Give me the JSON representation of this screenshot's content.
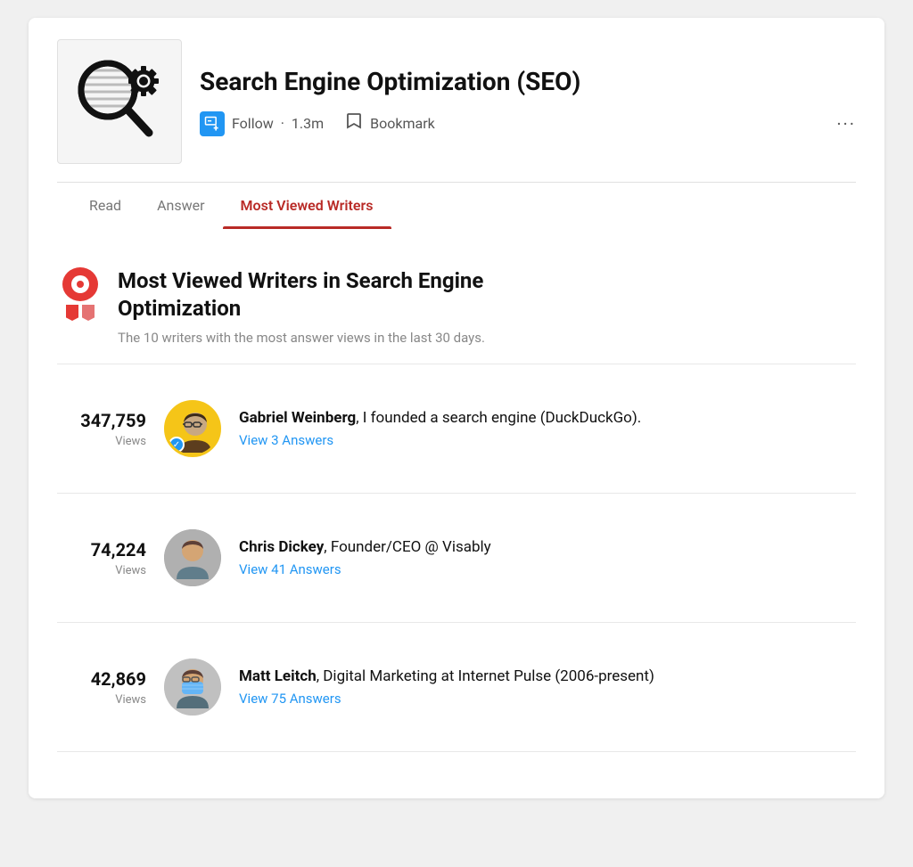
{
  "topic": {
    "title": "Search Engine Optimization (SEO)",
    "follow_label": "Follow",
    "follow_count": "1.3m",
    "bookmark_label": "Bookmark",
    "more_icon": "···"
  },
  "tabs": [
    {
      "id": "read",
      "label": "Read",
      "active": false
    },
    {
      "id": "answer",
      "label": "Answer",
      "active": false
    },
    {
      "id": "most-viewed-writers",
      "label": "Most Viewed Writers",
      "active": true
    }
  ],
  "mvw_section": {
    "heading_line1": "Most Viewed Writers in Search Engine",
    "heading_line2": "Optimization",
    "subtitle": "The 10 writers with the most answer views in the last 30 days.",
    "writers": [
      {
        "rank": 1,
        "views_count": "347,759",
        "views_label": "Views",
        "name": "Gabriel Weinberg",
        "tagline": ", I founded a search engine (DuckDuckGo).",
        "answers_link": "View 3 Answers",
        "verified": true,
        "avatar_color": "#f5c518",
        "avatar_type": "gabriel"
      },
      {
        "rank": 2,
        "views_count": "74,224",
        "views_label": "Views",
        "name": "Chris Dickey",
        "tagline": ", Founder/CEO @ Visably",
        "answers_link": "View 41 Answers",
        "verified": false,
        "avatar_color": "#9e9e9e",
        "avatar_type": "chris"
      },
      {
        "rank": 3,
        "views_count": "42,869",
        "views_label": "Views",
        "name": "Matt Leitch",
        "tagline": ", Digital Marketing at Internet Pulse (2006-present)",
        "answers_link": "View 75 Answers",
        "verified": false,
        "avatar_color": "#bdbdbd",
        "avatar_type": "matt"
      }
    ]
  },
  "colors": {
    "active_tab": "#b92b27",
    "link_blue": "#2196f3",
    "verified_blue": "#2196f3",
    "badge_red": "#e53935"
  }
}
